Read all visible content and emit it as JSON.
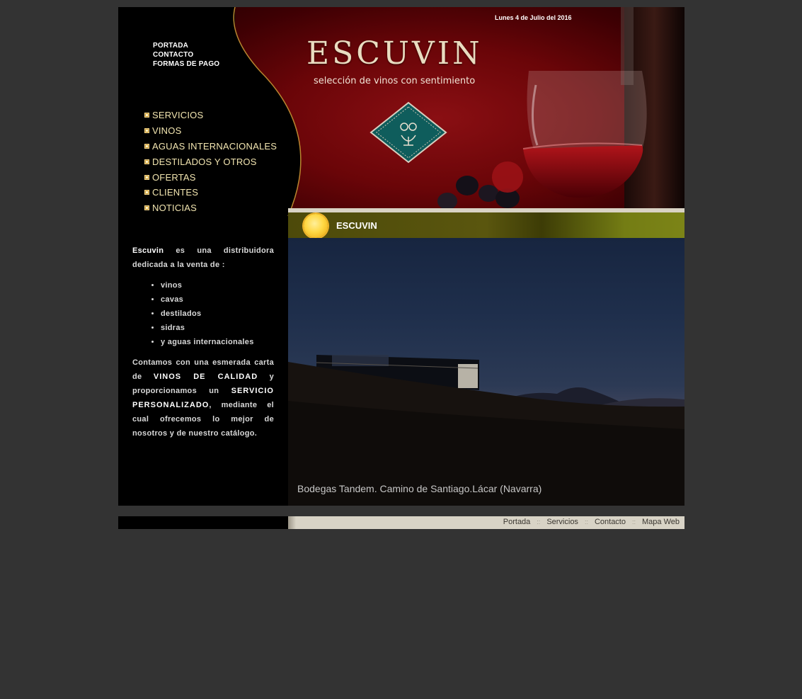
{
  "header": {
    "date": "Lunes 4 de Julio del 2016",
    "brand": "ESCUVIN",
    "tagline": "selección de vinos con sentimiento"
  },
  "top_nav": [
    "PORTADA",
    "CONTACTO",
    "FORMAS DE PAGO"
  ],
  "main_nav": [
    "SERVICIOS",
    "VINOS",
    "AGUAS INTERNACIONALES",
    "DESTILADOS Y OTROS",
    "OFERTAS",
    "CLIENTES",
    "NOTICIAS"
  ],
  "intro": {
    "brand": "Escuvin",
    "lead": "es una distribuidora dedicada a la venta de :",
    "items": [
      "vinos",
      "cavas",
      "destilados",
      "sidras",
      "y aguas internacionales"
    ],
    "p2_a": "Contamos con una esmerada carta de",
    "p2_hl1": "VINOS DE CALIDAD",
    "p2_b": "y proporcionamos un",
    "p2_hl2": "SERVICIO PERSONALIZADO",
    "p2_c": ", mediante el cual ofrecemos lo mejor de nosotros y de nuestro catálogo."
  },
  "section": {
    "title": "ESCUVIN"
  },
  "photo": {
    "caption": "Bodegas Tandem. Camino de Santiago.Lácar (Navarra)"
  },
  "footer": {
    "links": [
      "Portada",
      "Servicios",
      "Contacto",
      "Mapa Web"
    ],
    "separator": "::"
  },
  "colors": {
    "page_bg": "#333333",
    "banner_red": "#6a0508",
    "nav_text": "#f2e5b0",
    "title_bar": "#5a560e"
  }
}
